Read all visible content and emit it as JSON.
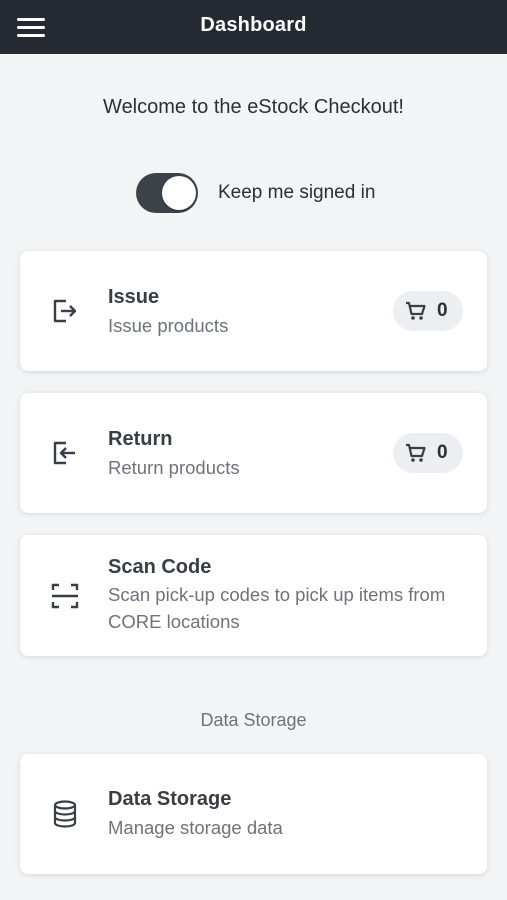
{
  "header": {
    "title": "Dashboard",
    "menu_icon": "hamburger-menu-icon"
  },
  "welcome_text": "Welcome to the eStock Checkout!",
  "keep_signed_in": {
    "label": "Keep me signed in",
    "enabled": true
  },
  "cards": {
    "issue": {
      "icon": "issue-export-icon",
      "title": "Issue",
      "subtitle": "Issue products",
      "cart_count": "0"
    },
    "return": {
      "icon": "return-import-icon",
      "title": "Return",
      "subtitle": "Return products",
      "cart_count": "0"
    },
    "scan": {
      "icon": "scan-frame-icon",
      "title": "Scan Code",
      "subtitle": "Scan pick-up codes to pick up items from CORE locations"
    }
  },
  "data_storage_section": {
    "heading": "Data Storage",
    "card": {
      "icon": "database-icon",
      "title": "Data Storage",
      "subtitle": "Manage storage data"
    }
  },
  "colors": {
    "app_bar": "#252a32",
    "background": "#f3f4f6",
    "toggle_on": "#3d4249"
  }
}
